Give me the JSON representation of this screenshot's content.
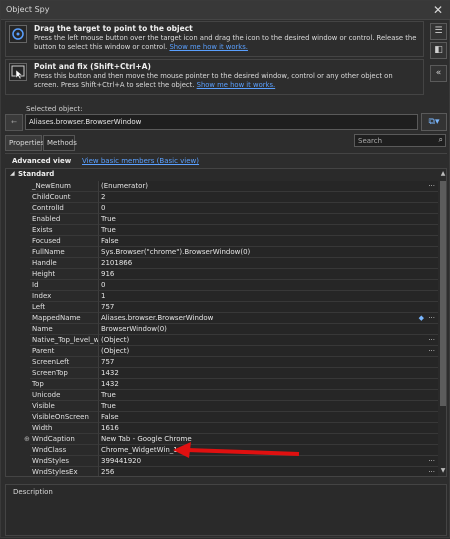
{
  "window": {
    "title": "Object Spy"
  },
  "drag_tool": {
    "title": "Drag the target to point to the object",
    "desc": "Press the left mouse button over the target icon and drag the icon to the desired window or control. Release the button to select this window or control.",
    "link": "Show me how it works."
  },
  "point_tool": {
    "title": "Point and fix (Shift+Ctrl+A)",
    "desc": "Press this button and then move the mouse pointer to the desired window, control or any other object on screen. Press Shift+Ctrl+A to select the object.",
    "link": "Show me how it works."
  },
  "selected": {
    "label": "Selected object:",
    "value": "Aliases.browser.BrowserWindow"
  },
  "tabs": [
    "Properties",
    "Methods"
  ],
  "search": {
    "placeholder": "Search"
  },
  "view": {
    "advanced": "Advanced view",
    "basic_link": "View basic members (Basic view)"
  },
  "group": "Standard",
  "properties": [
    {
      "name": "_NewEnum",
      "value": "(Enumerator)",
      "dots": true
    },
    {
      "name": "ChildCount",
      "value": "2"
    },
    {
      "name": "ControlId",
      "value": "0"
    },
    {
      "name": "Enabled",
      "value": "True"
    },
    {
      "name": "Exists",
      "value": "True"
    },
    {
      "name": "Focused",
      "value": "False"
    },
    {
      "name": "FullName",
      "value": "Sys.Browser(\"chrome\").BrowserWindow(0)"
    },
    {
      "name": "Handle",
      "value": "2101866"
    },
    {
      "name": "Height",
      "value": "916"
    },
    {
      "name": "Id",
      "value": "0"
    },
    {
      "name": "Index",
      "value": "1"
    },
    {
      "name": "Left",
      "value": "757"
    },
    {
      "name": "MappedName",
      "value": "Aliases.browser.BrowserWindow",
      "dots": true,
      "diamond": true
    },
    {
      "name": "Name",
      "value": "BrowserWindow(0)"
    },
    {
      "name": "Native_Top_level_window",
      "value": "(Object)",
      "dots": true
    },
    {
      "name": "Parent",
      "value": "(Object)",
      "dots": true
    },
    {
      "name": "ScreenLeft",
      "value": "757"
    },
    {
      "name": "ScreenTop",
      "value": "1432"
    },
    {
      "name": "Top",
      "value": "1432"
    },
    {
      "name": "Unicode",
      "value": "True"
    },
    {
      "name": "Visible",
      "value": "True"
    },
    {
      "name": "VisibleOnScreen",
      "value": "False"
    },
    {
      "name": "Width",
      "value": "1616"
    },
    {
      "name": "WndCaption",
      "value": "New Tab - Google Chrome",
      "plus": true
    },
    {
      "name": "WndClass",
      "value": "Chrome_WidgetWin_1"
    },
    {
      "name": "WndStyles",
      "value": "399441920",
      "dots": true
    },
    {
      "name": "WndStylesEx",
      "value": "256",
      "dots": true
    }
  ],
  "description": {
    "label": "Description"
  },
  "colors": {
    "accent": "#5aa0ff",
    "annotation": "#e01010"
  }
}
